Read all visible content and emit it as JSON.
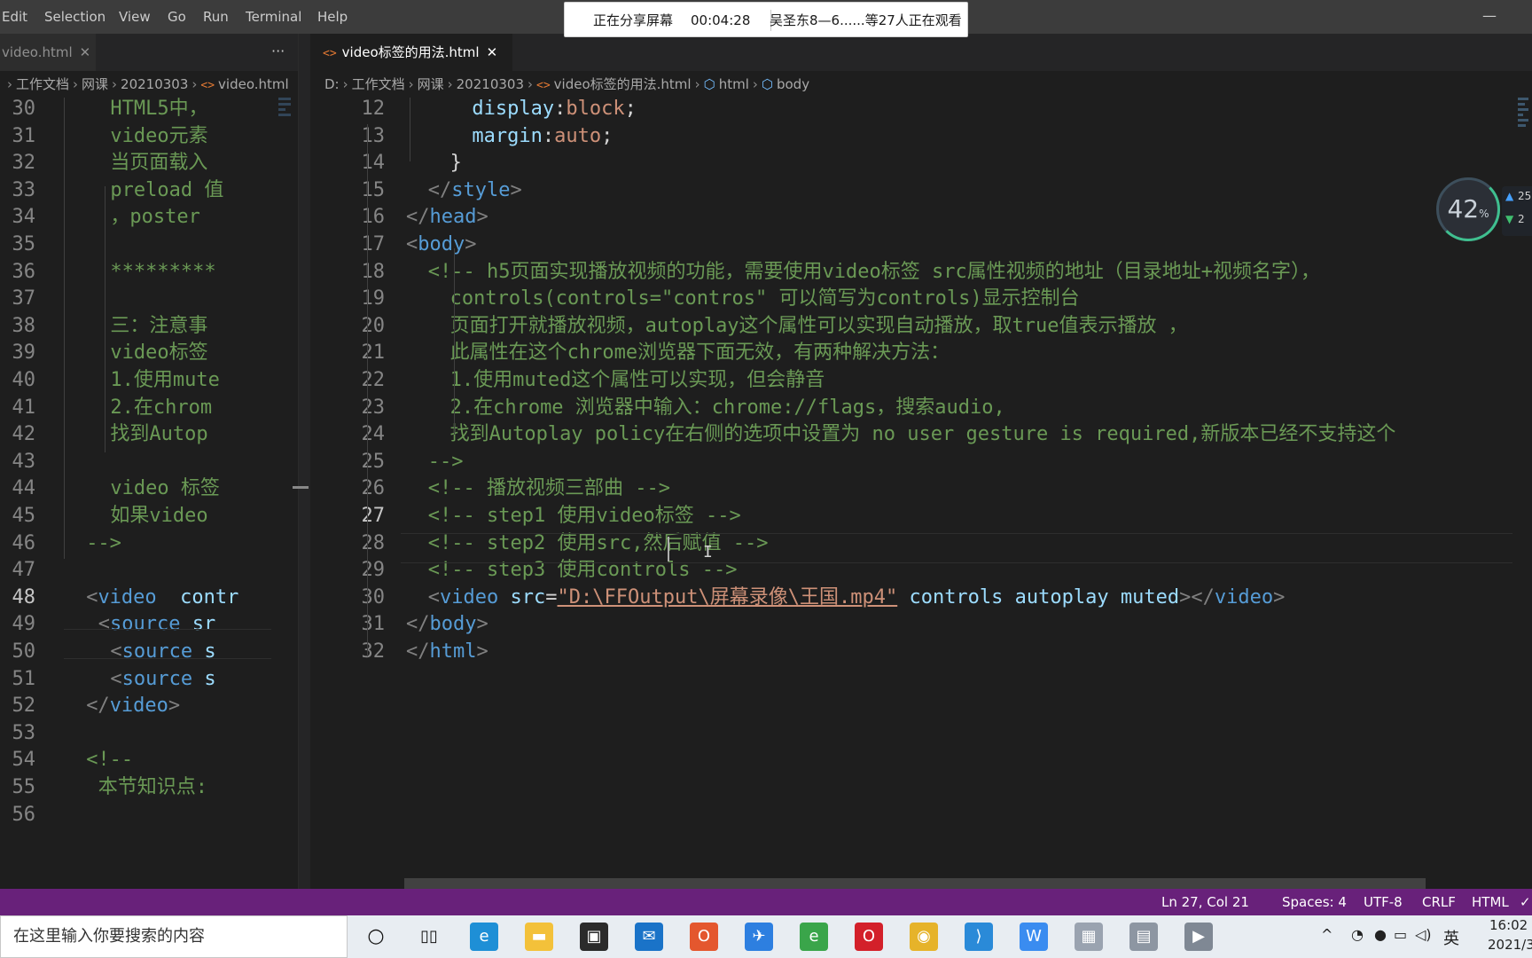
{
  "menu": [
    "Edit",
    "Selection",
    "View",
    "Go",
    "Run",
    "Terminal",
    "Help"
  ],
  "share_banner": {
    "status": "正在分享屏幕",
    "time": "00:04:28",
    "viewers": "吴圣东8—6......等27人正在观看"
  },
  "left_pane": {
    "tab_label": "video.html",
    "more": "···",
    "breadcrumb": [
      "工作文档",
      "网课",
      "20210303",
      "video.html"
    ],
    "lines": [
      {
        "n": "30",
        "text": "HTML5中，"
      },
      {
        "n": "31",
        "text": "video元素"
      },
      {
        "n": "32",
        "text": "当页面载入"
      },
      {
        "n": "33",
        "text": "preload 值"
      },
      {
        "n": "34",
        "text": "，poster"
      },
      {
        "n": "35",
        "text": ""
      },
      {
        "n": "36",
        "text": "*********"
      },
      {
        "n": "37",
        "text": ""
      },
      {
        "n": "38",
        "text": "三：注意事"
      },
      {
        "n": "39",
        "text": "video标签"
      },
      {
        "n": "40",
        "text": "1.使用mute"
      },
      {
        "n": "41",
        "text": "2.在chrom"
      },
      {
        "n": "42",
        "text": "找到Autop"
      },
      {
        "n": "43",
        "text": ""
      },
      {
        "n": "44",
        "text": "video 标签"
      },
      {
        "n": "45",
        "text": "如果video"
      },
      {
        "n": "46",
        "text": "-->"
      },
      {
        "n": "47",
        "text": ""
      },
      {
        "n": "48",
        "text": "video  contr"
      },
      {
        "n": "49",
        "text": "source sr"
      },
      {
        "n": "50",
        "text": "source s"
      },
      {
        "n": "51",
        "text": "source s"
      },
      {
        "n": "52",
        "text": "video"
      },
      {
        "n": "53",
        "text": ""
      },
      {
        "n": "54",
        "text": "<!--"
      },
      {
        "n": "55",
        "text": "本节知识点:"
      },
      {
        "n": "56",
        "text": ""
      }
    ],
    "current_line": "48"
  },
  "right_pane": {
    "tab_label": "video标签的用法.html",
    "breadcrumb": [
      "D:",
      "工作文档",
      "网课",
      "20210303",
      "video标签的用法.html",
      "html",
      "body"
    ],
    "lines": [
      {
        "n": "12",
        "prop": "display",
        "val": "block"
      },
      {
        "n": "13",
        "prop": "margin",
        "val": "auto"
      },
      {
        "n": "14",
        "text": "}"
      },
      {
        "n": "15",
        "tag": "style"
      },
      {
        "n": "16",
        "tag": "head"
      },
      {
        "n": "17",
        "tag": "body"
      },
      {
        "n": "18",
        "text": "<!-- h5页面实现播放视频的功能，需要使用video标签 src属性视频的地址（目录地址+视频名字），"
      },
      {
        "n": "19",
        "text": "controls(controls=\"contros\" 可以简写为controls)显示控制台"
      },
      {
        "n": "20",
        "text": "页面打开就播放视频，autoplay这个属性可以实现自动播放，取true值表示播放 ，"
      },
      {
        "n": "21",
        "text": "此属性在这个chrome浏览器下面无效，有两种解决方法："
      },
      {
        "n": "22",
        "text": "1.使用muted这个属性可以实现，但会静音"
      },
      {
        "n": "23",
        "text": "2.在chrome 浏览器中输入：chrome://flags，搜索audio,"
      },
      {
        "n": "24",
        "text": "找到Autoplay policy在右侧的选项中设置为 no user gesture is required,新版本已经不支持这个"
      },
      {
        "n": "25",
        "text": "-->"
      },
      {
        "n": "26",
        "text": "<!-- 播放视频三部曲 -->"
      },
      {
        "n": "27",
        "text": "<!-- step1 使用video标签 -->"
      },
      {
        "n": "28",
        "text": "<!-- step2 使用src,然后赋值 -->"
      },
      {
        "n": "29",
        "text": "<!-- step3 使用controls -->"
      },
      {
        "n": "30",
        "tag": "video",
        "attr_src": "src",
        "src": "\"D:\\FFOutput\\屏幕录像\\王国.mp4\"",
        "attrs": "controls autoplay muted"
      },
      {
        "n": "31",
        "tag": "body"
      },
      {
        "n": "32",
        "tag": "html"
      }
    ],
    "current_line": "27"
  },
  "net_widget": {
    "percent": "42",
    "unit": "%",
    "up": "25",
    "down": "2"
  },
  "statusbar": {
    "position": "Ln 27, Col 21",
    "spaces": "Spaces: 4",
    "encoding": "UTF-8",
    "eol": "CRLF",
    "language": "HTML",
    "eslint": "✓ ESLint"
  },
  "taskbar": {
    "search_placeholder": "在这里输入你要搜索的内容",
    "ime": "英",
    "time": "16:02",
    "date": "2021/3"
  },
  "colors": {
    "statusbar": "#68217a",
    "tag": "#569cd6",
    "attr": "#9cdcfe",
    "string": "#ce9178",
    "comment": "#6a9955"
  }
}
